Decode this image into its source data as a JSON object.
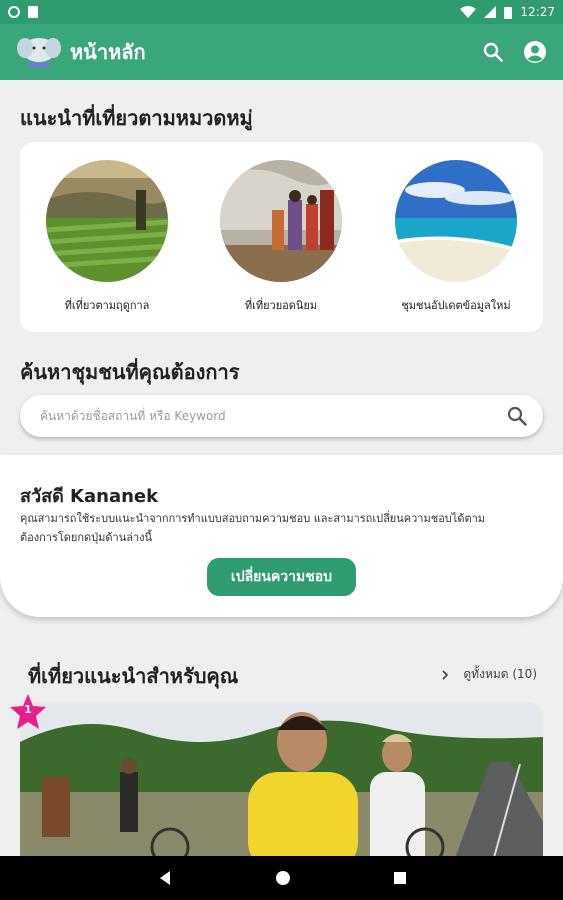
{
  "status_bar": {
    "time": "12:27"
  },
  "app_bar": {
    "title": "หน้าหลัก"
  },
  "categories_section": {
    "title": "แนะนำที่เที่ยวตามหมวดหมู่",
    "items": [
      {
        "label": "ที่เที่ยวตามฤดูกาล",
        "icon": "tea-plantation-photo"
      },
      {
        "label": "ที่เที่ยวยอดนิยม",
        "icon": "festival-photo"
      },
      {
        "label": "ชุมชนอัปเดตข้อมูลใหม่",
        "icon": "beach-photo"
      }
    ]
  },
  "search_section": {
    "title": "ค้นหาชุมชนที่คุณต้องการ",
    "placeholder": "ค้นหาด้วยชื่อสถานที่ หรือ Keyword"
  },
  "preference": {
    "greeting": "สวัสดี Kananek",
    "description": "คุณสามารถใช้ระบบแนะนำจากการทำแบบสอบถามความชอบ และสามารถเปลี่ยนความชอบได้ตามต้องการโดยกดปุ่มด้านล่างนี้",
    "button_label": "เปลี่ยนความชอบ"
  },
  "recommendations": {
    "title": "ที่เที่ยวแนะนำสำหรับคุณ",
    "see_all": "ดูทั้งหมด (10)",
    "badge": "1"
  },
  "colors": {
    "primary": "#3aa77a",
    "primary_dark": "#2e9c6e",
    "badge": "#e91e8c"
  }
}
